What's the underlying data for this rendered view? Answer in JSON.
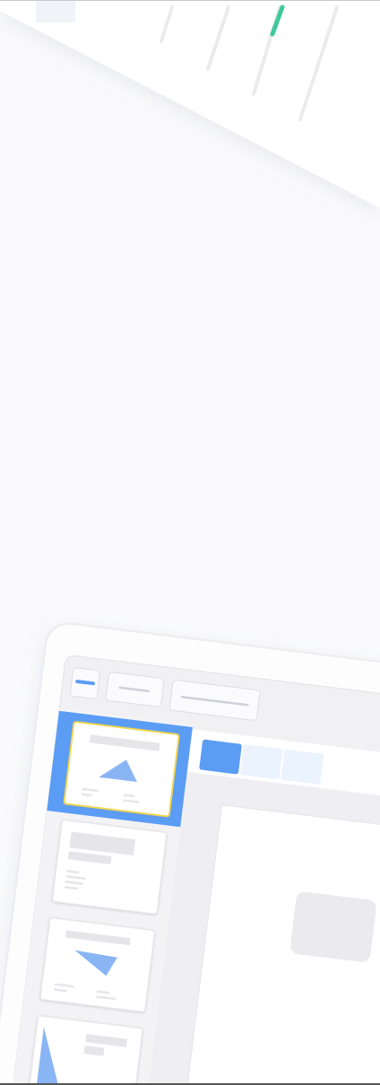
{
  "toolbar": {
    "buttons": [
      {
        "kind": "accent"
      },
      {
        "kind": "short"
      },
      {
        "kind": "long"
      }
    ]
  },
  "view_tabs": [
    {
      "selected": true
    },
    {
      "selected": false
    },
    {
      "selected": false
    }
  ],
  "slides": [
    {
      "kind": "triangle-up",
      "selected": true
    },
    {
      "kind": "text",
      "selected": false
    },
    {
      "kind": "triangle-down",
      "selected": false
    },
    {
      "kind": "triangle-side",
      "selected": false
    }
  ]
}
